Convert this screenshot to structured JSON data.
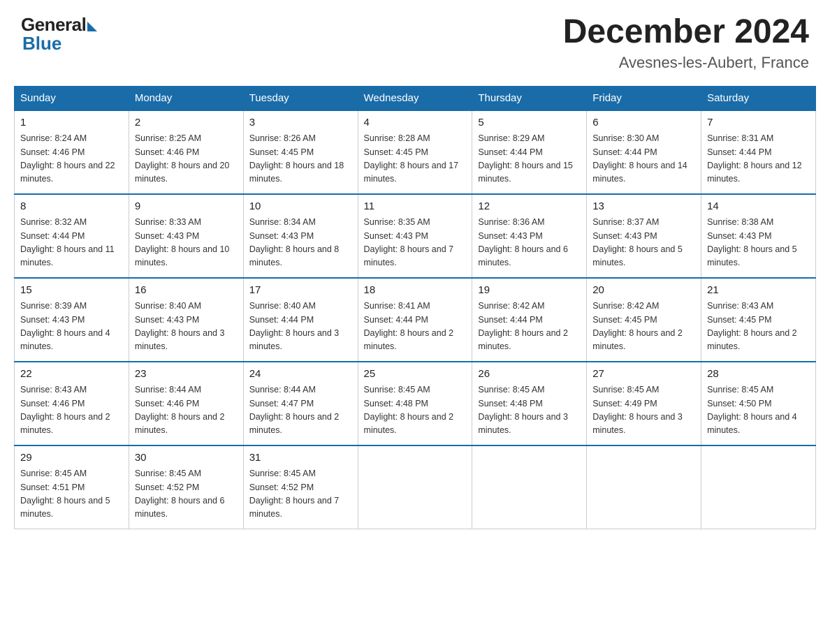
{
  "header": {
    "logo_general": "General",
    "logo_blue": "Blue",
    "month_year": "December 2024",
    "location": "Avesnes-les-Aubert, France"
  },
  "days_of_week": [
    "Sunday",
    "Monday",
    "Tuesday",
    "Wednesday",
    "Thursday",
    "Friday",
    "Saturday"
  ],
  "weeks": [
    [
      {
        "day": 1,
        "sunrise": "8:24 AM",
        "sunset": "4:46 PM",
        "daylight": "8 hours and 22 minutes."
      },
      {
        "day": 2,
        "sunrise": "8:25 AM",
        "sunset": "4:46 PM",
        "daylight": "8 hours and 20 minutes."
      },
      {
        "day": 3,
        "sunrise": "8:26 AM",
        "sunset": "4:45 PM",
        "daylight": "8 hours and 18 minutes."
      },
      {
        "day": 4,
        "sunrise": "8:28 AM",
        "sunset": "4:45 PM",
        "daylight": "8 hours and 17 minutes."
      },
      {
        "day": 5,
        "sunrise": "8:29 AM",
        "sunset": "4:44 PM",
        "daylight": "8 hours and 15 minutes."
      },
      {
        "day": 6,
        "sunrise": "8:30 AM",
        "sunset": "4:44 PM",
        "daylight": "8 hours and 14 minutes."
      },
      {
        "day": 7,
        "sunrise": "8:31 AM",
        "sunset": "4:44 PM",
        "daylight": "8 hours and 12 minutes."
      }
    ],
    [
      {
        "day": 8,
        "sunrise": "8:32 AM",
        "sunset": "4:44 PM",
        "daylight": "8 hours and 11 minutes."
      },
      {
        "day": 9,
        "sunrise": "8:33 AM",
        "sunset": "4:43 PM",
        "daylight": "8 hours and 10 minutes."
      },
      {
        "day": 10,
        "sunrise": "8:34 AM",
        "sunset": "4:43 PM",
        "daylight": "8 hours and 8 minutes."
      },
      {
        "day": 11,
        "sunrise": "8:35 AM",
        "sunset": "4:43 PM",
        "daylight": "8 hours and 7 minutes."
      },
      {
        "day": 12,
        "sunrise": "8:36 AM",
        "sunset": "4:43 PM",
        "daylight": "8 hours and 6 minutes."
      },
      {
        "day": 13,
        "sunrise": "8:37 AM",
        "sunset": "4:43 PM",
        "daylight": "8 hours and 5 minutes."
      },
      {
        "day": 14,
        "sunrise": "8:38 AM",
        "sunset": "4:43 PM",
        "daylight": "8 hours and 5 minutes."
      }
    ],
    [
      {
        "day": 15,
        "sunrise": "8:39 AM",
        "sunset": "4:43 PM",
        "daylight": "8 hours and 4 minutes."
      },
      {
        "day": 16,
        "sunrise": "8:40 AM",
        "sunset": "4:43 PM",
        "daylight": "8 hours and 3 minutes."
      },
      {
        "day": 17,
        "sunrise": "8:40 AM",
        "sunset": "4:44 PM",
        "daylight": "8 hours and 3 minutes."
      },
      {
        "day": 18,
        "sunrise": "8:41 AM",
        "sunset": "4:44 PM",
        "daylight": "8 hours and 2 minutes."
      },
      {
        "day": 19,
        "sunrise": "8:42 AM",
        "sunset": "4:44 PM",
        "daylight": "8 hours and 2 minutes."
      },
      {
        "day": 20,
        "sunrise": "8:42 AM",
        "sunset": "4:45 PM",
        "daylight": "8 hours and 2 minutes."
      },
      {
        "day": 21,
        "sunrise": "8:43 AM",
        "sunset": "4:45 PM",
        "daylight": "8 hours and 2 minutes."
      }
    ],
    [
      {
        "day": 22,
        "sunrise": "8:43 AM",
        "sunset": "4:46 PM",
        "daylight": "8 hours and 2 minutes."
      },
      {
        "day": 23,
        "sunrise": "8:44 AM",
        "sunset": "4:46 PM",
        "daylight": "8 hours and 2 minutes."
      },
      {
        "day": 24,
        "sunrise": "8:44 AM",
        "sunset": "4:47 PM",
        "daylight": "8 hours and 2 minutes."
      },
      {
        "day": 25,
        "sunrise": "8:45 AM",
        "sunset": "4:48 PM",
        "daylight": "8 hours and 2 minutes."
      },
      {
        "day": 26,
        "sunrise": "8:45 AM",
        "sunset": "4:48 PM",
        "daylight": "8 hours and 3 minutes."
      },
      {
        "day": 27,
        "sunrise": "8:45 AM",
        "sunset": "4:49 PM",
        "daylight": "8 hours and 3 minutes."
      },
      {
        "day": 28,
        "sunrise": "8:45 AM",
        "sunset": "4:50 PM",
        "daylight": "8 hours and 4 minutes."
      }
    ],
    [
      {
        "day": 29,
        "sunrise": "8:45 AM",
        "sunset": "4:51 PM",
        "daylight": "8 hours and 5 minutes."
      },
      {
        "day": 30,
        "sunrise": "8:45 AM",
        "sunset": "4:52 PM",
        "daylight": "8 hours and 6 minutes."
      },
      {
        "day": 31,
        "sunrise": "8:45 AM",
        "sunset": "4:52 PM",
        "daylight": "8 hours and 7 minutes."
      },
      null,
      null,
      null,
      null
    ]
  ]
}
